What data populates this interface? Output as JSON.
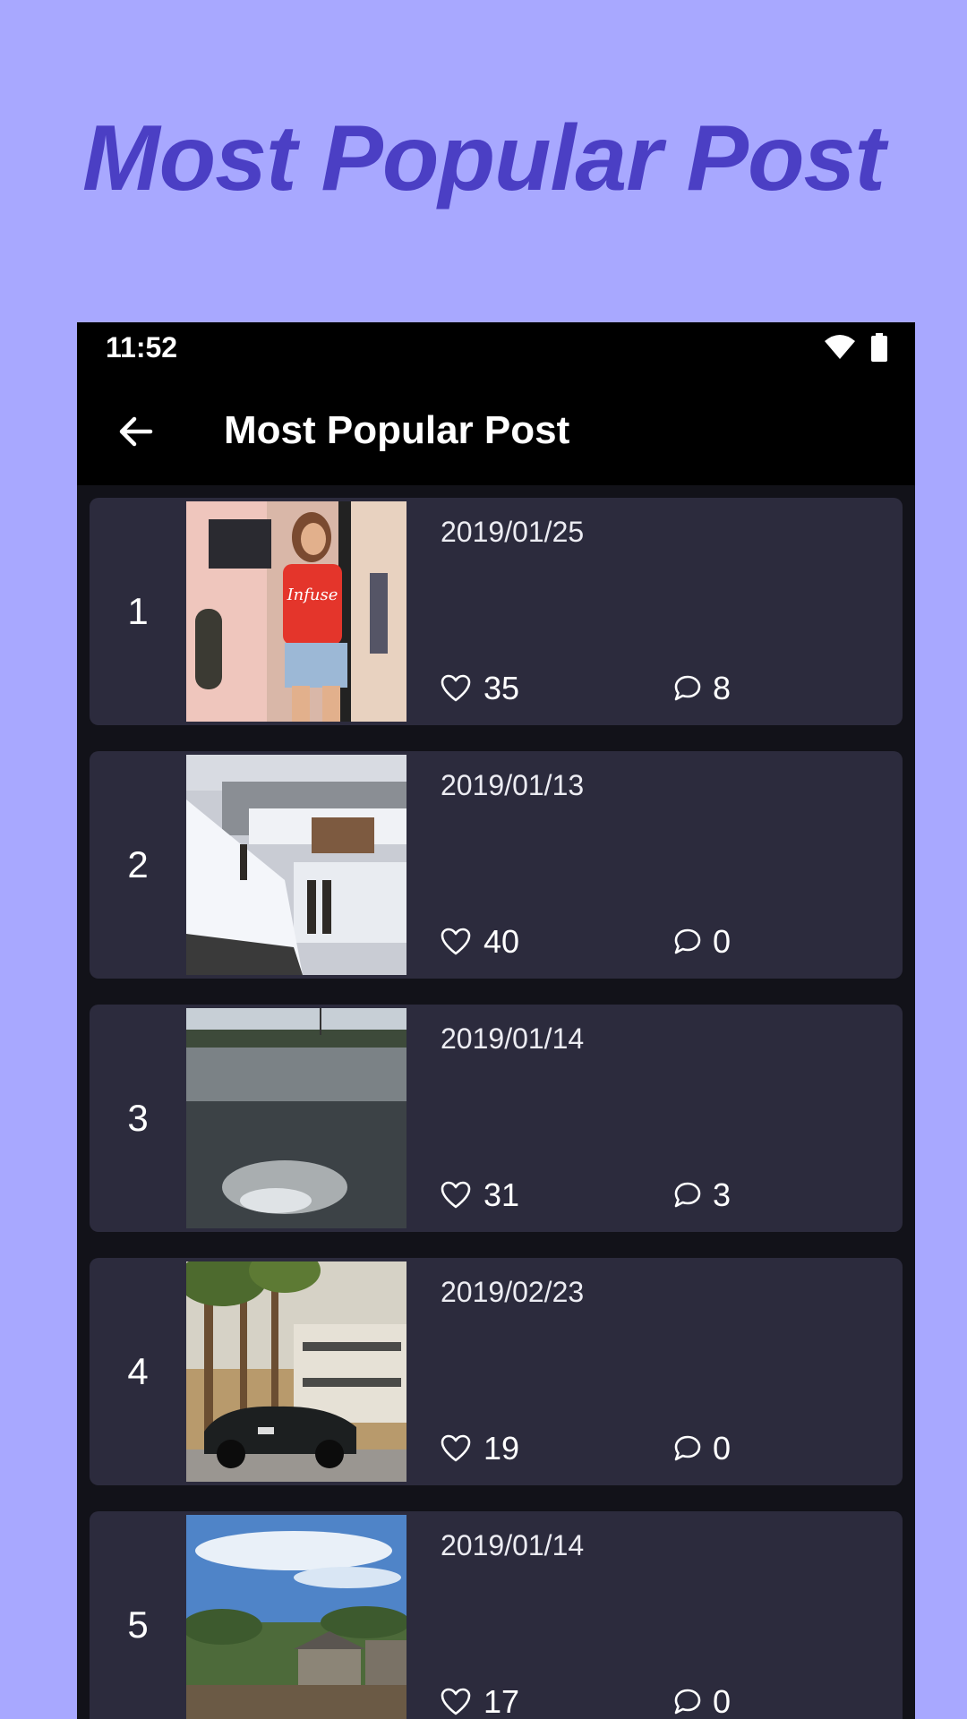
{
  "promo": {
    "title": "Most Popular Post"
  },
  "status_bar": {
    "time": "11:52",
    "wifi_icon": "wifi-icon",
    "battery_icon": "battery-icon"
  },
  "app_bar": {
    "back_icon": "arrow-left-icon",
    "title": "Most Popular Post"
  },
  "posts": [
    {
      "rank": "1",
      "date": "2019/01/25",
      "likes": "35",
      "comments": "8",
      "image": "woman in red t-shirt and denim shorts"
    },
    {
      "rank": "2",
      "date": "2019/01/13",
      "likes": "40",
      "comments": "0",
      "image": "snowy village rooftops"
    },
    {
      "rank": "3",
      "date": "2019/01/14",
      "likes": "31",
      "comments": "3",
      "image": "rippling water with sun glare"
    },
    {
      "rank": "4",
      "date": "2019/02/23",
      "likes": "19",
      "comments": "0",
      "image": "black sports car under palm trees"
    },
    {
      "rank": "5",
      "date": "2019/01/14",
      "likes": "17",
      "comments": "0",
      "image": "blue sky over village houses"
    }
  ],
  "colors": {
    "background": "#a8a8ff",
    "promo_title": "#4b3fc4",
    "screen": "#121219",
    "card": "#2c2b3d",
    "bar": "#000000"
  }
}
